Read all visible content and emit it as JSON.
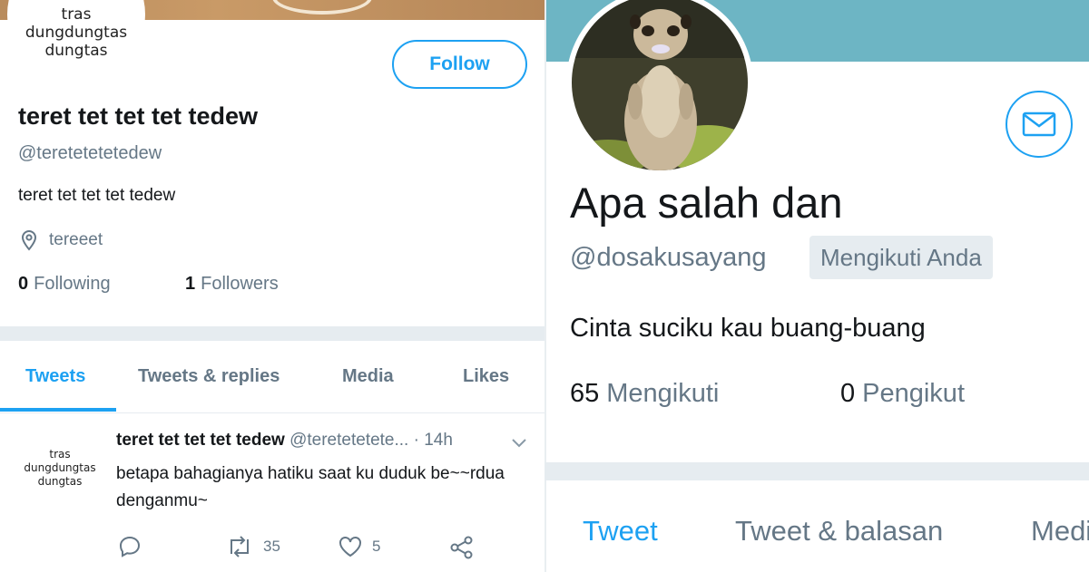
{
  "colors": {
    "accent": "#1da1f2",
    "muted": "#657786",
    "text": "#14171a",
    "divider": "#e6ecf0",
    "right_banner": "#6db5c4"
  },
  "left": {
    "avatar_lines": [
      "tras",
      "dungdungtas",
      "dungtas"
    ],
    "follow_label": "Follow",
    "name": "teret tet tet tet tedew",
    "handle": "@teretetetetedew",
    "bio": "teret tet tet tet tedew",
    "location": "tereeet",
    "following_count": "0",
    "following_label": "Following",
    "followers_count": "1",
    "followers_label": "Followers",
    "tabs": [
      "Tweets",
      "Tweets & replies",
      "Media",
      "Likes"
    ],
    "tweet": {
      "author_name": "teret tet tet tet tedew",
      "author_handle": "@teretetetete...",
      "time": "· 14h",
      "text": "betapa bahagianya hatiku saat ku duduk be~~rdua denganmu~",
      "retweet_count": "35",
      "like_count": "5"
    }
  },
  "right": {
    "name": "Apa salah dan",
    "handle": "@dosakusayang",
    "follows_you_badge": "Mengikuti Anda",
    "bio": "Cinta suciku kau buang-buang",
    "following_count": "65",
    "following_label": "Mengikuti",
    "followers_count": "0",
    "followers_label": "Pengikut",
    "tabs": [
      "Tweet",
      "Tweet & balasan",
      "Media"
    ]
  }
}
